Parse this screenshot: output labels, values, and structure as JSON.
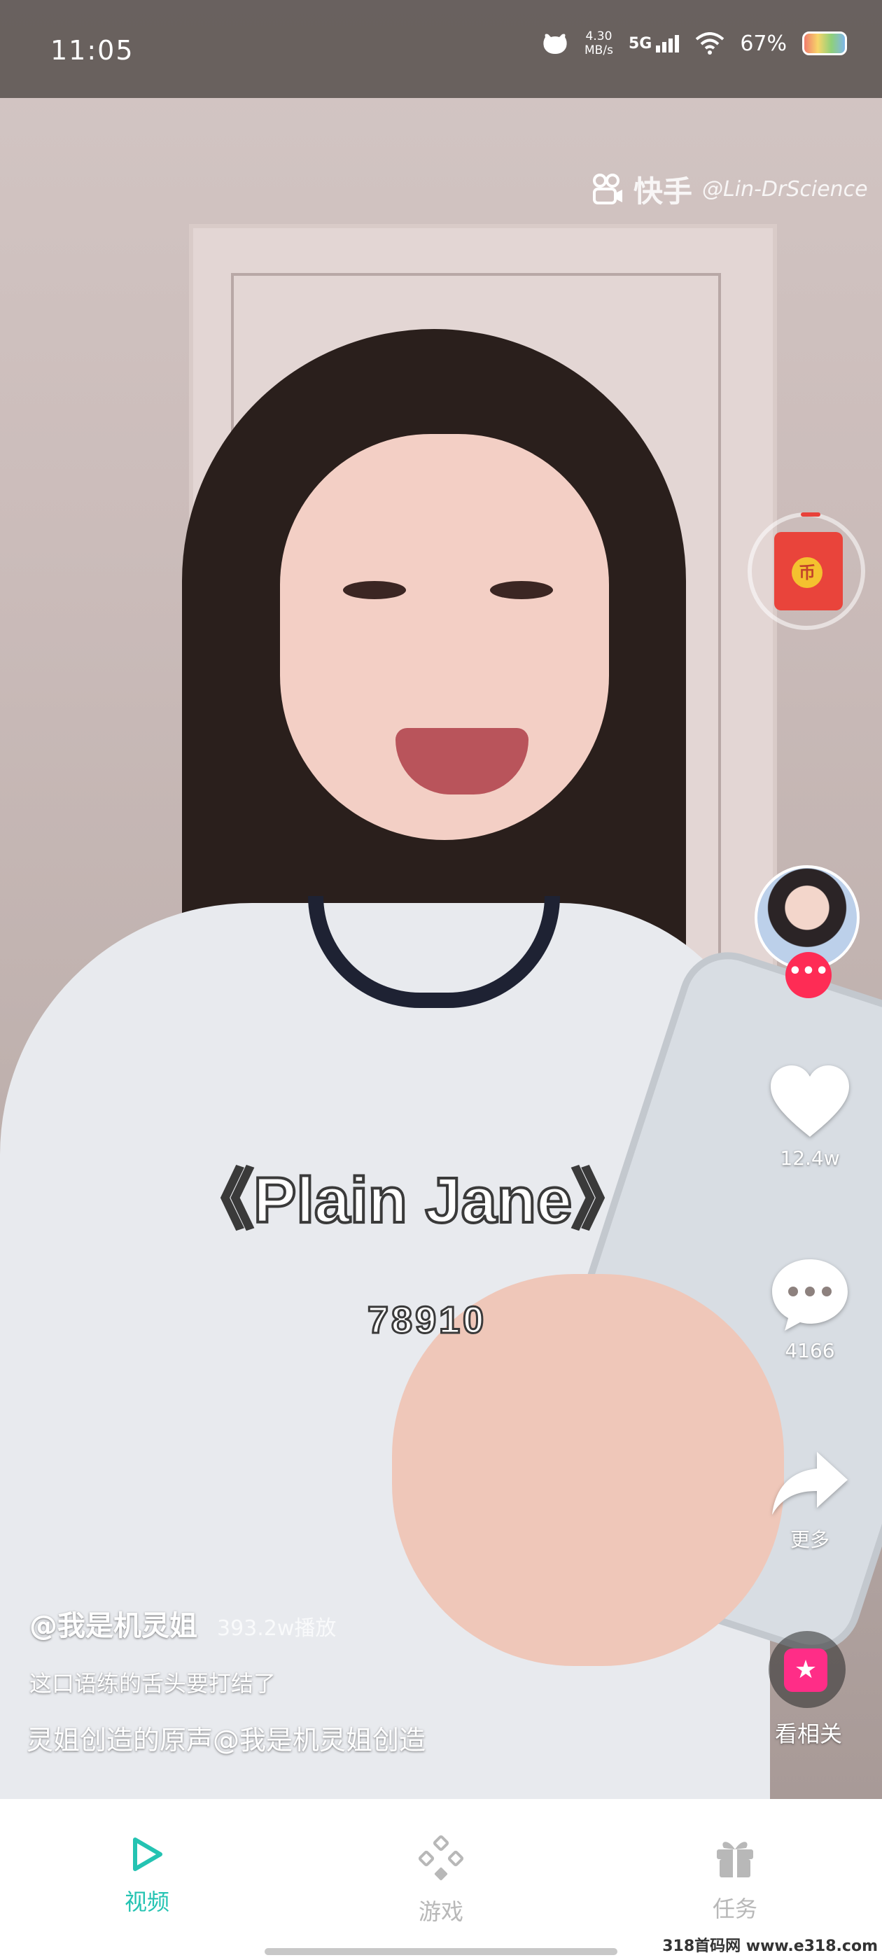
{
  "status_bar": {
    "time": "11:05",
    "net_speed_value": "4.30",
    "net_speed_unit": "MB/s",
    "network": "5G",
    "battery": "67%"
  },
  "watermark": {
    "brand": "快手",
    "user": "@Lin-DrScience"
  },
  "video_overlay": {
    "title": "《Plain Jane》",
    "numbers": "78910"
  },
  "reward": {
    "coin_label": "币"
  },
  "side_actions": {
    "like_count": "12.4w",
    "comment_count": "4166",
    "share_label": "更多",
    "related_label": "看相关"
  },
  "info": {
    "author": "@我是机灵姐",
    "plays": "393.2w播放",
    "caption": "这口语练的舌头要打结了",
    "music": "灵姐创造的原声@我是机灵姐创造"
  },
  "bottom_nav": {
    "items": [
      {
        "label": "视频",
        "icon": "play-icon",
        "active": true
      },
      {
        "label": "游戏",
        "icon": "gamepad-icon",
        "active": false
      },
      {
        "label": "任务",
        "icon": "gift-icon",
        "active": false
      }
    ],
    "active_color": "#24c3b2",
    "inactive_color": "#b8b8b8"
  },
  "site_mark": "318首码网 www.e318.com"
}
